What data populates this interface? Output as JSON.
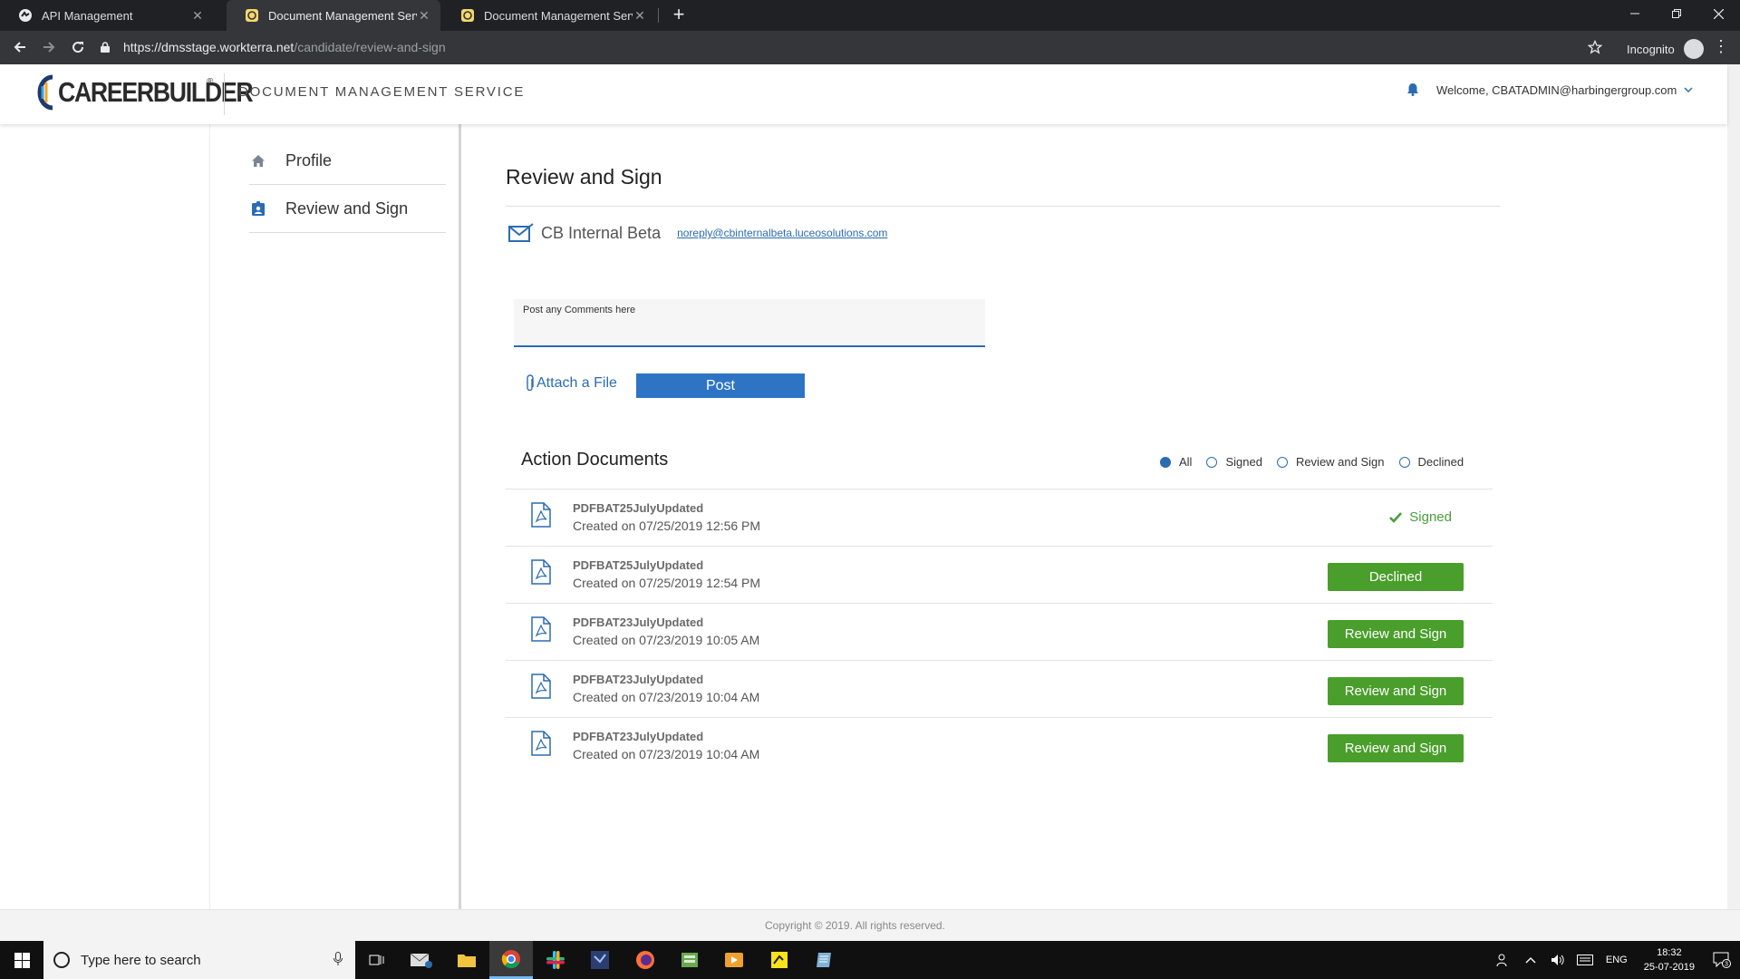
{
  "browser": {
    "tabs": [
      {
        "title": "API Management",
        "active": false
      },
      {
        "title": "Document Management Service",
        "active": true
      },
      {
        "title": "Document Management Service",
        "active": false
      }
    ],
    "url_host": "https://dmsstage.workterra.net",
    "url_path": "/candidate/review-and-sign",
    "profile_label": "Incognito"
  },
  "header": {
    "logo_text": "CAREERBUILDER",
    "logo_tm": "®",
    "service_name": "DOCUMENT MANAGEMENT SERVICE",
    "welcome": "Welcome, CBATADMIN@harbingergroup.com"
  },
  "sidebar": {
    "items": [
      {
        "label": "Profile",
        "icon": "home-icon"
      },
      {
        "label": "Review and Sign",
        "icon": "badge-icon"
      }
    ]
  },
  "main": {
    "title": "Review and Sign",
    "sender_name": "CB Internal Beta",
    "sender_email": "noreply@cbinternalbeta.luceosolutions.com",
    "comment_label": "Post any Comments here",
    "comment_value": "",
    "attach_label": "Attach a File",
    "post_label": "Post",
    "action_title": "Action Documents",
    "filters": [
      {
        "label": "All",
        "checked": true
      },
      {
        "label": "Signed",
        "checked": false
      },
      {
        "label": "Review and Sign",
        "checked": false
      },
      {
        "label": "Declined",
        "checked": false
      }
    ],
    "documents": [
      {
        "name": "PDFBAT25JulyUpdated",
        "created": "Created on 07/25/2019 12:56 PM",
        "status": "Signed",
        "kind": "status"
      },
      {
        "name": "PDFBAT25JulyUpdated",
        "created": "Created on 07/25/2019 12:54 PM",
        "status": "Declined",
        "kind": "button"
      },
      {
        "name": "PDFBAT23JulyUpdated",
        "created": "Created on 07/23/2019 10:05 AM",
        "status": "Review and Sign",
        "kind": "button"
      },
      {
        "name": "PDFBAT23JulyUpdated",
        "created": "Created on 07/23/2019 10:04 AM",
        "status": "Review and Sign",
        "kind": "button"
      },
      {
        "name": "PDFBAT23JulyUpdated",
        "created": "Created on 07/23/2019 10:04 AM",
        "status": "Review and Sign",
        "kind": "button"
      }
    ]
  },
  "footer": {
    "copyright": "Copyright © 2019. All rights reserved."
  },
  "taskbar": {
    "search_placeholder": "Type here to search",
    "language": "ENG",
    "time": "18:32",
    "date": "25-07-2019",
    "notification_count": "3"
  },
  "colors": {
    "accent_blue": "#2b6cb0",
    "button_blue": "#2e74c4",
    "success_green": "#4a9e2b"
  }
}
